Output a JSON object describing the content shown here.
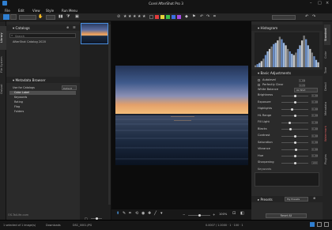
{
  "window": {
    "title": "Corel AfterShot Pro 3"
  },
  "menu": [
    "File",
    "Edit",
    "View",
    "Style",
    "Run Menu"
  ],
  "toolbar": {
    "zoom_label": "100%",
    "preset_dropdown": "",
    "colors": [
      "#e23b3b",
      "#e8d23b",
      "#3bbf4a",
      "#3b6fe2",
      "#a64ae2"
    ]
  },
  "left_tabs": [
    "Library",
    "File System",
    "Output"
  ],
  "catalogs": {
    "title": "Catalogs",
    "search_placeholder": "Search",
    "items": [
      "AfterShot Catalog 2020"
    ]
  },
  "metadata": {
    "title": "Metadata Browser",
    "selector": "Default",
    "items": [
      "Use for Catalogs",
      "Color Label",
      "Keywords",
      "Rating",
      "Flag",
      "Folders"
    ]
  },
  "right_tabs": [
    "Standard",
    "Color",
    "Tone",
    "Detail",
    "Metadata",
    "Watermark",
    "Plugins"
  ],
  "histogram": {
    "title": "Histogram",
    "values": [
      3,
      5,
      7,
      10,
      14,
      20,
      26,
      30,
      34,
      38,
      40,
      44,
      50,
      46,
      40,
      36,
      30,
      26,
      22,
      20,
      24,
      30,
      36,
      44,
      52,
      46,
      36,
      30,
      24,
      18,
      12,
      8
    ]
  },
  "basic": {
    "title": "Basic Adjustments",
    "checks": [
      {
        "label": "Autolevel",
        "value": "1.00"
      },
      {
        "label": "Perfectly Clear",
        "value": "Auto"
      }
    ],
    "white_balance": {
      "label": "White Balance",
      "value": "As Shot"
    },
    "sliders": [
      {
        "label": "Brightness",
        "value": "0.00",
        "pos": 0.5
      },
      {
        "label": "Exposure",
        "value": "0.00",
        "pos": 0.5
      },
      {
        "label": "Highlights",
        "value": "0.00",
        "pos": 0.4
      },
      {
        "label": "HL Range",
        "value": "0.00",
        "pos": 0.5
      },
      {
        "label": "Fill Light",
        "value": "0.00",
        "pos": 0.3
      },
      {
        "label": "Blacks",
        "value": "0.00",
        "pos": 0.35
      },
      {
        "label": "Contrast",
        "value": "0.00",
        "pos": 0.5
      },
      {
        "label": "Saturation",
        "value": "0.00",
        "pos": 0.5
      },
      {
        "label": "Vibrance",
        "value": "0.00",
        "pos": 0.55
      },
      {
        "label": "Hue",
        "value": "0.00",
        "pos": 0.5
      },
      {
        "label": "Sharpening",
        "value": "100",
        "pos": 0.5
      }
    ],
    "keywords_label": "Keywords"
  },
  "presets": {
    "title": "Presets",
    "selector": "My Presets",
    "reset_label": "Reset All"
  },
  "viewer": {
    "zoom": "100%",
    "bottom_label": "OS-TaiLife.com"
  },
  "status": {
    "left": "1 selected of 1 image(s)",
    "path": "Downloads",
    "file": "DSC_0001.JPG",
    "info": "0.0007 / 1.0000 · 1 · 100 · 1"
  }
}
